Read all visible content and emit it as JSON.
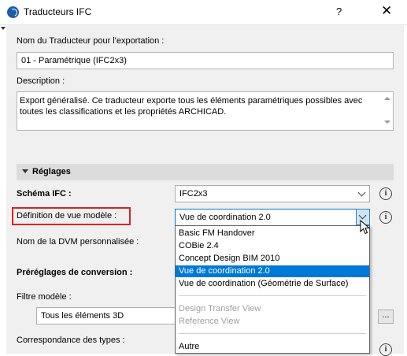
{
  "window": {
    "title": "Traducteurs IFC",
    "help_label": "?",
    "close_label": "✕"
  },
  "translator": {
    "name_label": "Nom du Traducteur pour l'exportation :",
    "name_value": "01 - Paramétrique (IFC2x3)",
    "description_label": "Description :",
    "description_value": "Export généralisé. Ce traducteur exporte tous les éléments paramétriques possibles avec toutes les classifications et les propriétés ARCHICAD."
  },
  "settings": {
    "section_title": "Réglages",
    "schema_label": "Schéma IFC :",
    "schema_value": "IFC2x3",
    "mvd_label": "Définition de vue modèle :",
    "mvd_value": "Vue de coordination 2.0",
    "custom_mvd_label": "Nom de la DVM personnalisée :",
    "conversion_label": "Préréglages de conversion :",
    "filter_label": "Filtre modèle :",
    "filter_value": "Tous les éléments 3D",
    "dots_label": "...",
    "type_mapping_label": "Correspondance des types :"
  },
  "dropdown": {
    "options": [
      {
        "label": "Basic FM Handover",
        "state": "normal"
      },
      {
        "label": "COBie 2.4",
        "state": "normal"
      },
      {
        "label": "Concept Design BIM 2010",
        "state": "normal"
      },
      {
        "label": "Vue de coordination 2.0",
        "state": "selected"
      },
      {
        "label": "Vue de coordination (Géométrie de Surface)",
        "state": "normal"
      },
      {
        "label": "Design Transfer View",
        "state": "disabled"
      },
      {
        "label": "Reference View",
        "state": "disabled"
      },
      {
        "label": "Autre",
        "state": "normal"
      }
    ]
  },
  "icons": {
    "app": "archicad-app-icon",
    "info": "info-icon",
    "chevron": "chevron-down-icon",
    "cursor": "mouse-pointer-icon"
  },
  "colors": {
    "selection": "#0078d7",
    "highlight_box": "#e02020",
    "panel": "#f0f0f0"
  }
}
